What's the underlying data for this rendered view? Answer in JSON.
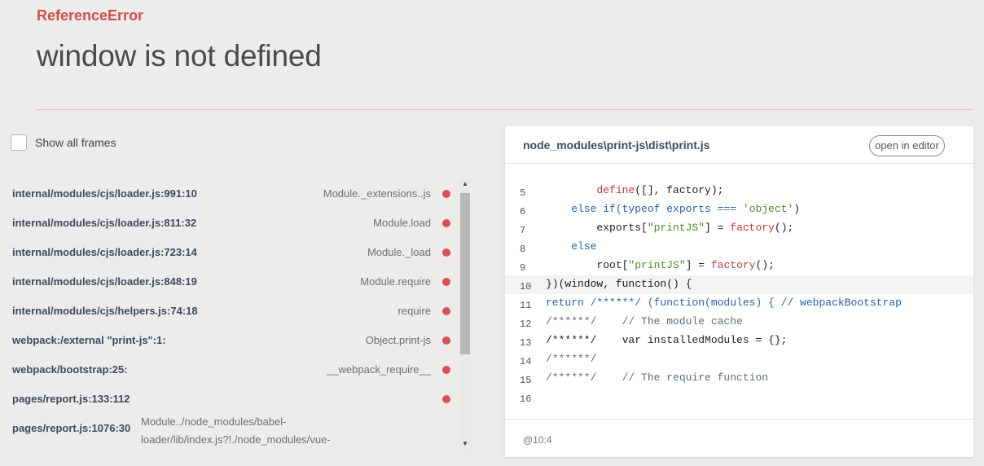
{
  "error": {
    "type": "ReferenceError",
    "message": "window is not defined"
  },
  "toggle": {
    "label": "Show all frames"
  },
  "frames": [
    {
      "location": "internal/modules/cjs/loader.js:991:10",
      "function": "Module._extensions..js"
    },
    {
      "location": "internal/modules/cjs/loader.js:811:32",
      "function": "Module.load"
    },
    {
      "location": "internal/modules/cjs/loader.js:723:14",
      "function": "Module._load"
    },
    {
      "location": "internal/modules/cjs/loader.js:848:19",
      "function": "Module.require"
    },
    {
      "location": "internal/modules/cjs/helpers.js:74:18",
      "function": "require"
    },
    {
      "location": "webpack:/external \"print-js\":1:",
      "function": "Object.print-js"
    },
    {
      "location": "webpack/bootstrap:25:",
      "function": "__webpack_require__"
    },
    {
      "location": "pages/report.js:133:112",
      "function": ""
    },
    {
      "location": "pages/report.js:1076:30",
      "function": "Module../node_modules/babel-loader/lib/index.js?!./node_modules/vue-"
    }
  ],
  "editor": {
    "file_path": "node_modules\\print-js\\dist\\print.js",
    "open_label": "open in editor",
    "position_label": "@10:4",
    "active_line": "10",
    "lines": [
      {
        "n": "5",
        "parts": {
          "a": "        ",
          "call1": "define",
          "rest": "([], factory);"
        }
      },
      {
        "n": "6",
        "parts": {
          "a": "    else if(typeof exports === ",
          "str": "'object'",
          "rest": ")"
        }
      },
      {
        "n": "7",
        "parts": {
          "a": "        exports[",
          "str": "\"printJS\"",
          "mid": "] = ",
          "call1": "factory",
          "rest": "();"
        }
      },
      {
        "n": "8",
        "parts": {
          "a": "    else"
        }
      },
      {
        "n": "9",
        "parts": {
          "a": "        root[",
          "str": "\"printJS\"",
          "mid": "] = ",
          "call1": "factory",
          "rest": "();"
        }
      },
      {
        "n": "10",
        "parts": {
          "a": "})(window, function() {"
        }
      },
      {
        "n": "11",
        "parts": {
          "a": "return /******/ (function(modules) { // webpackBootstrap"
        }
      },
      {
        "n": "12",
        "parts": {
          "a": "/******/    // The module cache"
        }
      },
      {
        "n": "13",
        "parts": {
          "a": "/******/    var installedModules = {};"
        }
      },
      {
        "n": "14",
        "parts": {
          "a": "/******/"
        }
      },
      {
        "n": "15",
        "parts": {
          "a": "/******/    // The require function"
        }
      },
      {
        "n": "16",
        "parts": {
          "a": ""
        }
      }
    ]
  }
}
